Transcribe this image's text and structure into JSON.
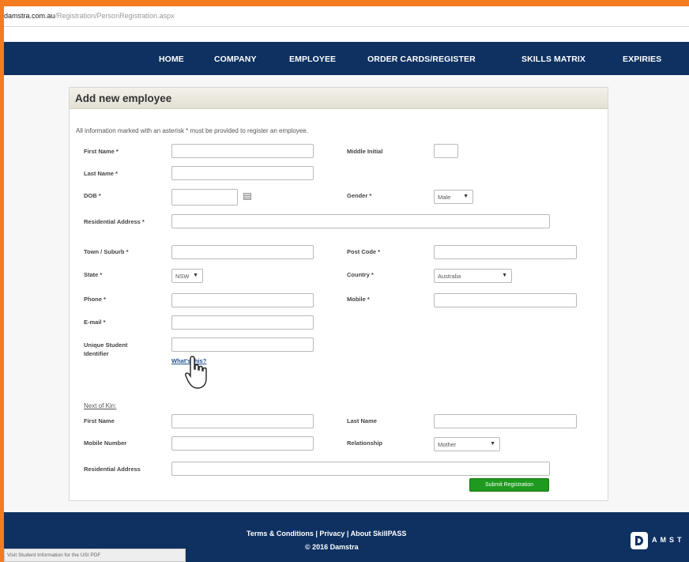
{
  "browser": {
    "url_domain": "damstra.com.au",
    "url_path": "/Registration/PersonRegistration.aspx"
  },
  "nav": {
    "items": [
      "HOME",
      "COMPANY",
      "EMPLOYEE",
      "ORDER CARDS/REGISTER",
      "SKILLS MATRIX",
      "EXPIRIES"
    ]
  },
  "form": {
    "title": "Add new employee",
    "info": "All information marked with an asterisk * must be provided to register an employee.",
    "labels": {
      "first_name": "First Name *",
      "middle_initial": "Middle Initial",
      "last_name": "Last Name *",
      "dob": "DOB *",
      "gender": "Gender *",
      "residential_address": "Residential Address *",
      "town": "Town / Suburb *",
      "post_code": "Post Code *",
      "state": "State *",
      "country": "Country *",
      "phone": "Phone *",
      "mobile": "Mobile *",
      "email": "E-mail *",
      "usi": "Unique Student Identifier"
    },
    "values": {
      "gender": "Male",
      "state": "NSW",
      "country": "Australia"
    },
    "whats_this": "What's this?",
    "next_of_kin": {
      "heading": "Next of Kin:",
      "labels": {
        "first_name": "First Name",
        "last_name": "Last Name",
        "mobile_number": "Mobile Number",
        "relationship": "Relationship",
        "residential_address": "Residential Address"
      },
      "values": {
        "relationship": "Mother"
      }
    },
    "submit_label": "Submit Registration"
  },
  "footer": {
    "links": "Terms & Conditions | Privacy | About SkillPASS",
    "copyright": "© 2016 Damstra",
    "logo_text": "AMST"
  },
  "status_bar": "Visit Student Information for the USI PDF",
  "colors": {
    "nav_bg": "#0e3161",
    "accent_orange": "#f47b20",
    "submit_green": "#1e9b1e"
  },
  "icons": [
    "calendar-icon",
    "caret-down-icon",
    "hand-pointer-icon",
    "damstra-logo"
  ]
}
